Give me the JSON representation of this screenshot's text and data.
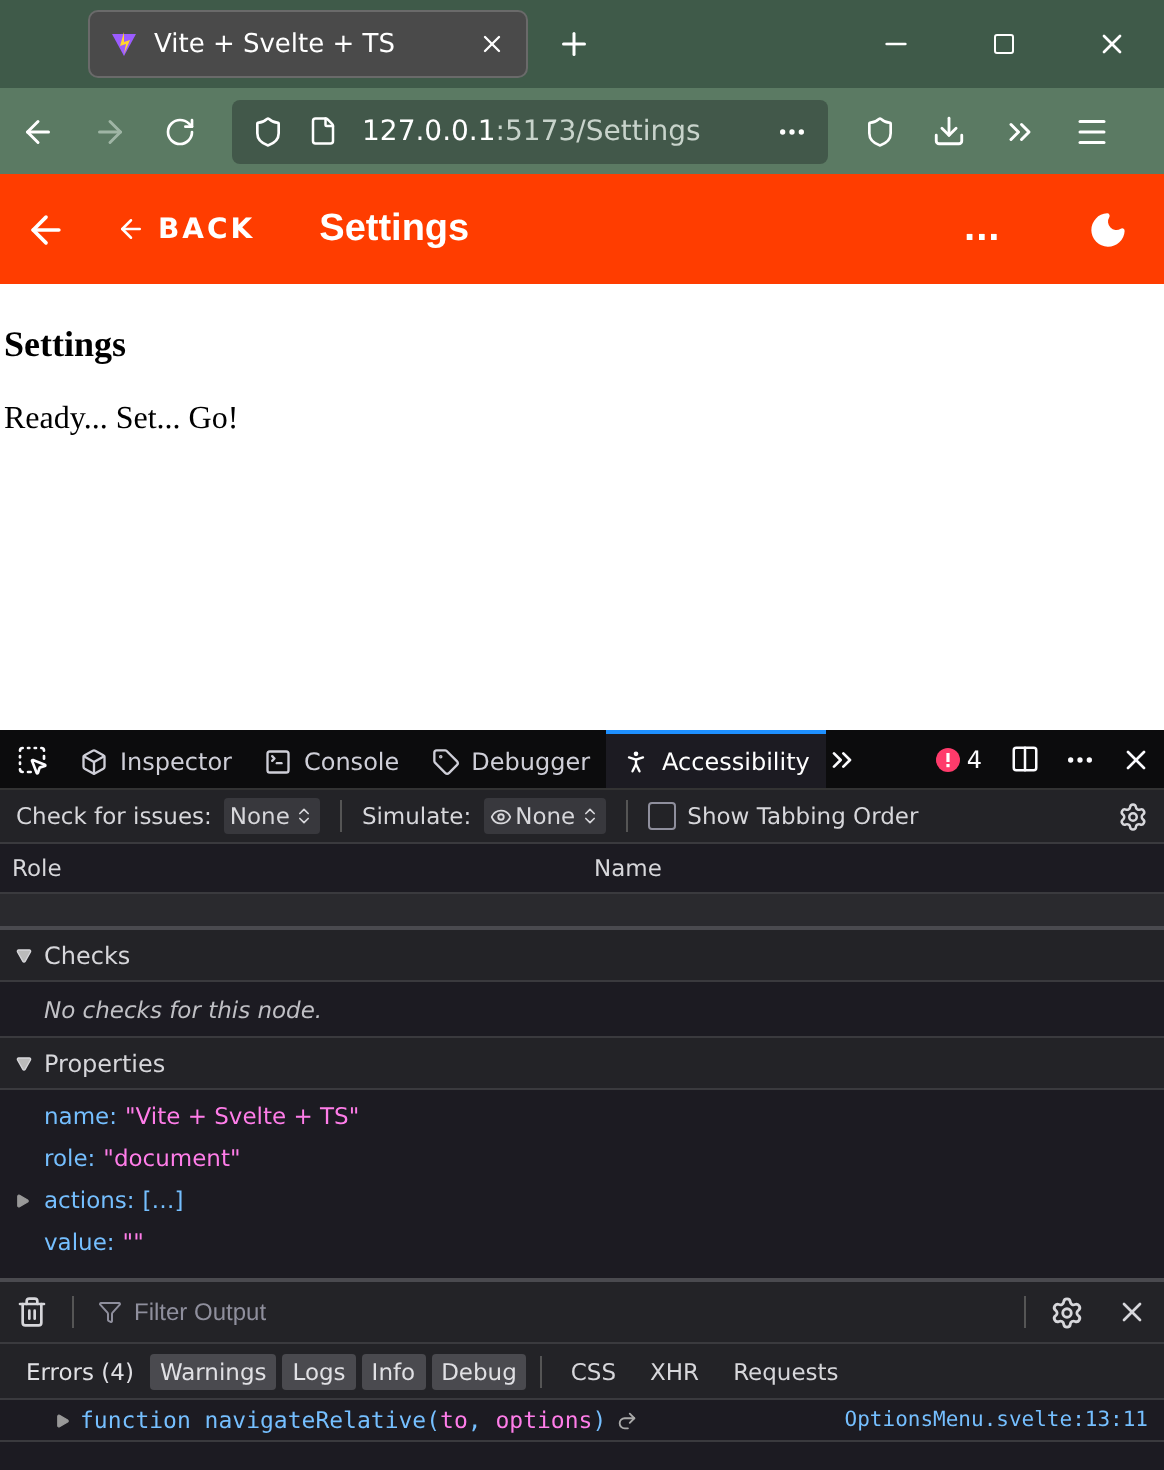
{
  "browser": {
    "tab_title": "Vite + Svelte + TS",
    "url_host": "127.0.0.1",
    "url_rest": ":5173/Settings"
  },
  "app_bar": {
    "back_label": "BACK",
    "title": "Settings",
    "more": "..."
  },
  "page": {
    "heading": "Settings",
    "text": "Ready... Set... Go!"
  },
  "devtools": {
    "tabs": [
      {
        "label": "Inspector",
        "selected": false
      },
      {
        "label": "Console",
        "selected": false
      },
      {
        "label": "Debugger",
        "selected": false
      },
      {
        "label": "Accessibility",
        "selected": true
      }
    ],
    "error_count": "4",
    "check_label": "Check for issues:",
    "check_value": "None",
    "simulate_label": "Simulate:",
    "simulate_value": "None",
    "tabbing": {
      "label": "Show Tabbing Order",
      "checked": false
    },
    "columns": [
      "Role",
      "Name"
    ],
    "sections": [
      {
        "title": "Checks",
        "expanded": true
      },
      {
        "title": "Properties",
        "expanded": true
      }
    ],
    "checks_note": "No checks for this node.",
    "properties": [
      {
        "key": "name:",
        "value": "\"Vite + Svelte + TS\"",
        "kind": "string",
        "expandable": false
      },
      {
        "key": "role:",
        "value": "\"document\"",
        "kind": "string",
        "expandable": false
      },
      {
        "key": "actions:",
        "value": "[…]",
        "kind": "array",
        "expandable": true
      },
      {
        "key": "value:",
        "value": "\"\"",
        "kind": "string",
        "expandable": false
      }
    ]
  },
  "console": {
    "filter_placeholder": "Filter Output",
    "filters": [
      {
        "label": "Errors (4)",
        "selected": false
      },
      {
        "label": "Warnings",
        "selected": true
      },
      {
        "label": "Logs",
        "selected": true
      },
      {
        "label": "Info",
        "selected": true
      },
      {
        "label": "Debug",
        "selected": true
      }
    ],
    "types": [
      "CSS",
      "XHR",
      "Requests"
    ],
    "message": {
      "parts": [
        {
          "text": "function navigateRelative(",
          "kind": "code"
        },
        {
          "text": "to",
          "kind": "param"
        },
        {
          "text": ", ",
          "kind": "code"
        },
        {
          "text": "options",
          "kind": "param"
        },
        {
          "text": ")",
          "kind": "code"
        }
      ],
      "source": "OptionsMenu.svelte:13:11"
    }
  }
}
